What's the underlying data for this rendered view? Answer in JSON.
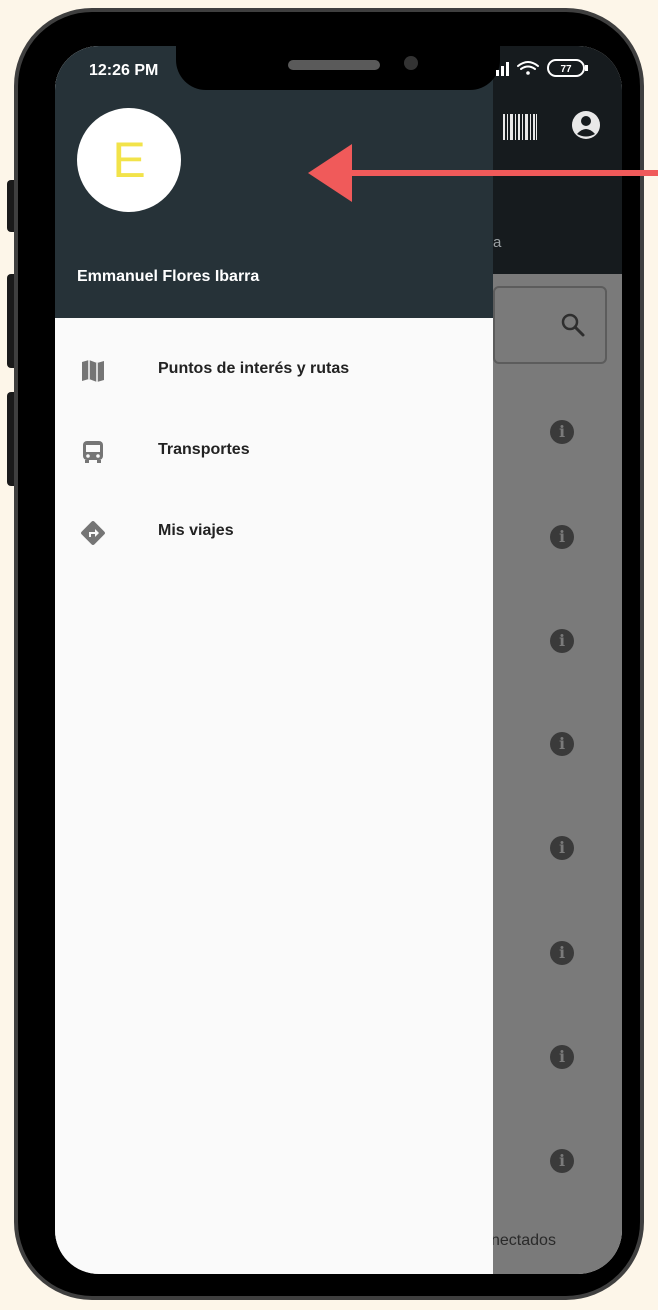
{
  "status_bar": {
    "time": "12:26 PM",
    "battery": "77"
  },
  "drawer": {
    "avatar_letter": "E",
    "user_name": "Emmanuel Flores Ibarra",
    "items": [
      {
        "label": "Puntos de interés y rutas",
        "icon": "map-icon"
      },
      {
        "label": "Transportes",
        "icon": "bus-icon"
      },
      {
        "label": "Mis viajes",
        "icon": "directions-icon"
      }
    ]
  },
  "background_app": {
    "tab_fragment": "a",
    "status_fragment": "nectados",
    "info_icon_glyph": "i",
    "info_icon_count": 8
  },
  "colors": {
    "drawer_header": "#263238",
    "app_bar": "#161b1e",
    "scrim": "#7a7a7a",
    "avatar_letter": "#f2e34a",
    "arrow": "#f05a5a",
    "frame_background": "#fdf6e9"
  }
}
